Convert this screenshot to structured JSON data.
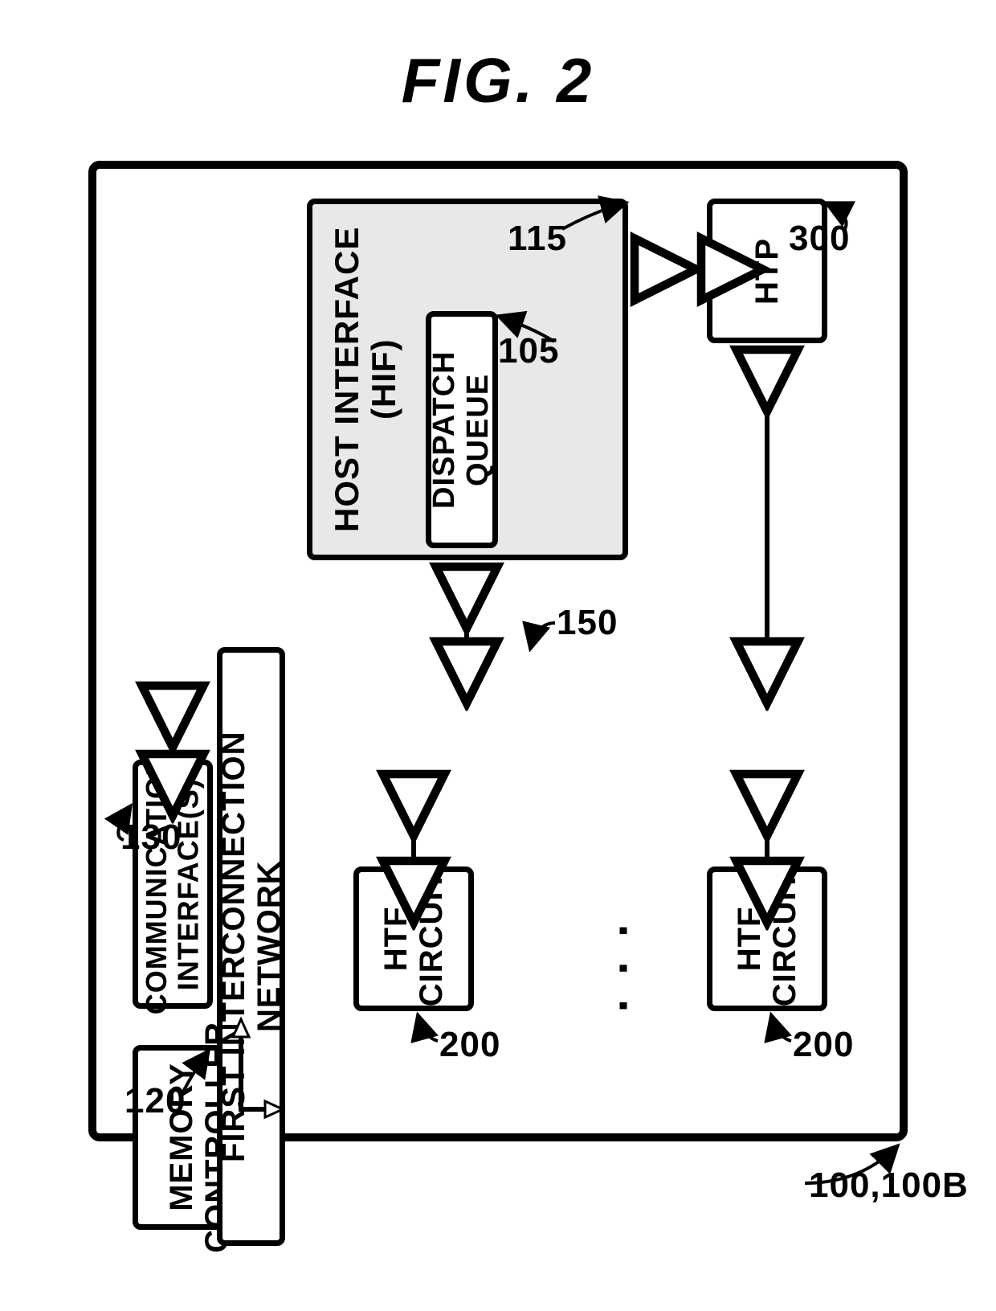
{
  "figure_title": "FIG. 2",
  "outer_ref": "100,100B",
  "blocks": {
    "comm_if": {
      "label": "COMMUNICATION\nINTERFACE(S)",
      "ref": "130"
    },
    "mem_ctrl": {
      "label": "MEMORY\nCONTROLLER",
      "ref": "120"
    },
    "hif": {
      "label": "HOST\nINTERFACE\n(HIF)",
      "ref": "115"
    },
    "dispatch": {
      "label": "DISPATCH QUEUE",
      "ref": "105"
    },
    "htp": {
      "label": "HTP",
      "ref": "300"
    },
    "net": {
      "label": "FIRST INTERCONNECTION NETWORK",
      "ref": "150"
    },
    "htf1": {
      "label": "HTF\nCIRCUIT",
      "ref": "200"
    },
    "htf2": {
      "label": "HTF\nCIRCUIT",
      "ref": "200"
    }
  }
}
